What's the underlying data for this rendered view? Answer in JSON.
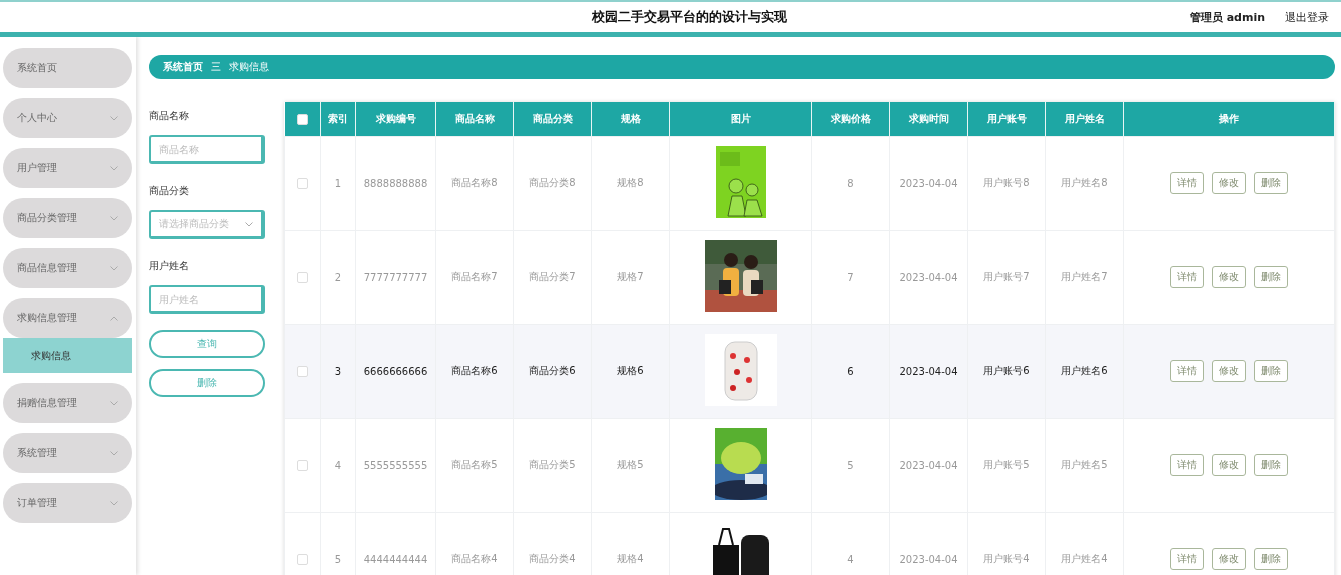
{
  "header": {
    "title": "校园二手交易平台的的设计与实现",
    "user": "管理员 admin",
    "logout": "退出登录"
  },
  "sidebar": {
    "items": [
      {
        "label": "系统首页",
        "kind": "link"
      },
      {
        "label": "个人中心",
        "kind": "menu",
        "expanded": false
      },
      {
        "label": "用户管理",
        "kind": "menu",
        "expanded": false
      },
      {
        "label": "商品分类管理",
        "kind": "menu",
        "expanded": false
      },
      {
        "label": "商品信息管理",
        "kind": "menu",
        "expanded": false
      },
      {
        "label": "求购信息管理",
        "kind": "menu",
        "expanded": true,
        "children": [
          {
            "label": "求购信息",
            "selected": true
          }
        ]
      },
      {
        "label": "捐赠信息管理",
        "kind": "menu",
        "expanded": false
      },
      {
        "label": "系统管理",
        "kind": "menu",
        "expanded": false
      },
      {
        "label": "订单管理",
        "kind": "menu",
        "expanded": false
      }
    ]
  },
  "breadcrumb": {
    "home": "系统首页",
    "separator": "三",
    "current": "求购信息"
  },
  "search": {
    "fields": [
      {
        "label": "商品名称",
        "kind": "input",
        "placeholder": "商品名称"
      },
      {
        "label": "商品分类",
        "kind": "select",
        "placeholder": "请选择商品分类"
      },
      {
        "label": "用户姓名",
        "kind": "input",
        "placeholder": "用户姓名"
      }
    ],
    "buttons": [
      "查询",
      "删除"
    ]
  },
  "table": {
    "header_checked": false,
    "columns": [
      "索引",
      "求购编号",
      "商品名称",
      "商品分类",
      "规格",
      "图片",
      "求购价格",
      "求购时间",
      "用户账号",
      "用户姓名",
      "操作"
    ],
    "rows": [
      {
        "checked": false,
        "highlighted": false,
        "actions": [
          "详情",
          "修改",
          "删除"
        ],
        "index": "1",
        "number": "8888888888",
        "name": "商品名称8",
        "category": "商品分类8",
        "spec": "规格8",
        "price": "8",
        "time": "2023-04-04",
        "account": "用户账号8",
        "user": "用户姓名8"
      },
      {
        "checked": false,
        "highlighted": false,
        "actions": [
          "详情",
          "修改",
          "删除"
        ],
        "index": "2",
        "number": "7777777777",
        "name": "商品名称7",
        "category": "商品分类7",
        "spec": "规格7",
        "price": "7",
        "time": "2023-04-04",
        "account": "用户账号7",
        "user": "用户姓名7"
      },
      {
        "checked": false,
        "highlighted": true,
        "actions": [
          "详情",
          "修改",
          "删除"
        ],
        "index": "3",
        "number": "6666666666",
        "name": "商品名称6",
        "category": "商品分类6",
        "spec": "规格6",
        "price": "6",
        "time": "2023-04-04",
        "account": "用户账号6",
        "user": "用户姓名6"
      },
      {
        "checked": false,
        "highlighted": false,
        "actions": [
          "详情",
          "修改",
          "删除"
        ],
        "index": "4",
        "number": "5555555555",
        "name": "商品名称5",
        "category": "商品分类5",
        "spec": "规格5",
        "price": "5",
        "time": "2023-04-04",
        "account": "用户账号5",
        "user": "用户姓名5"
      },
      {
        "checked": false,
        "highlighted": false,
        "actions": [
          "详情",
          "修改",
          "删除"
        ],
        "index": "5",
        "number": "4444444444",
        "name": "商品名称4",
        "category": "商品分类4",
        "spec": "规格4",
        "price": "4",
        "time": "2023-04-04",
        "account": "用户账号4",
        "user": "用户姓名4"
      }
    ]
  }
}
